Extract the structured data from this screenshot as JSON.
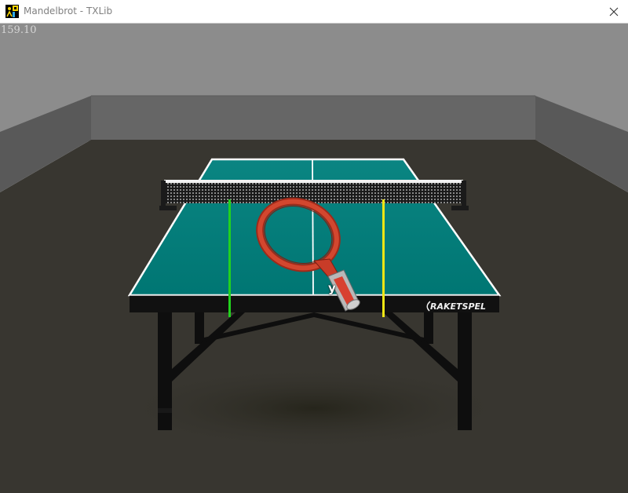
{
  "window": {
    "title": "Mandelbrot - TXLib",
    "close_icon": "close-icon",
    "app_icon": "txlib-app-icon"
  },
  "hud": {
    "fps": "159.10"
  },
  "scene": {
    "table_brand": "RAKETSPEL",
    "paddle_label": "y",
    "colors": {
      "ceiling": "#8c8c8c",
      "back_wall": "#666666",
      "side_wall": "#5a5a5a",
      "floor": "#383630",
      "table_top": "#007a78",
      "table_edge": "#101010",
      "paddle": "#c83c28",
      "left_marker": "#22d21e",
      "right_marker": "#f0e614"
    }
  }
}
